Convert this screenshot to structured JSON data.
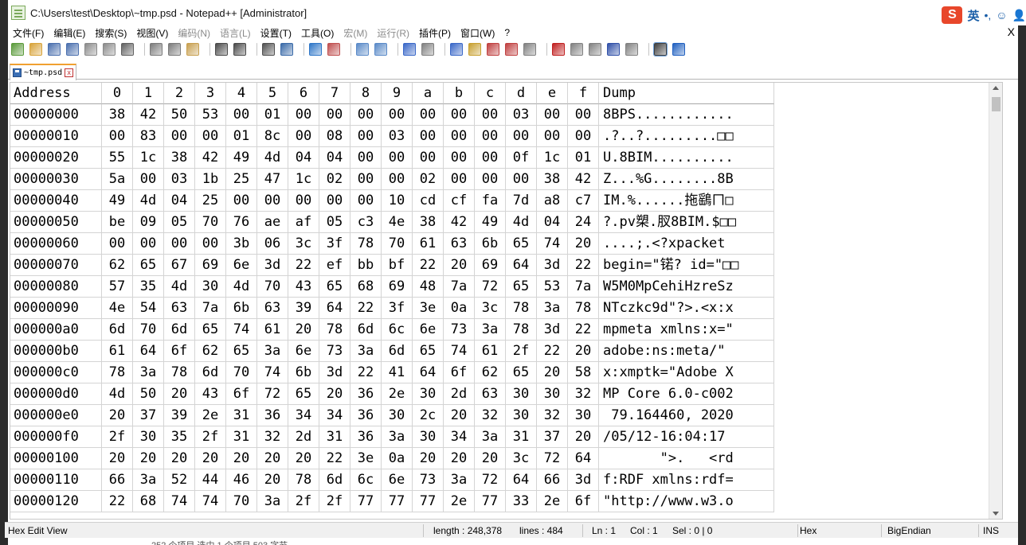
{
  "window": {
    "title": "C:\\Users\\test\\Desktop\\~tmp.psd - Notepad++ [Administrator]"
  },
  "ime": {
    "logo": "S",
    "lang": "英",
    "punct": "•,",
    "emoji": "☺",
    "user": "👤"
  },
  "close_symbol": "X",
  "menu": [
    {
      "label": "文件(F)",
      "disabled": false
    },
    {
      "label": "编辑(E)",
      "disabled": false
    },
    {
      "label": "搜索(S)",
      "disabled": false
    },
    {
      "label": "视图(V)",
      "disabled": false
    },
    {
      "label": "编码(N)",
      "disabled": true
    },
    {
      "label": "语言(L)",
      "disabled": true
    },
    {
      "label": "设置(T)",
      "disabled": false
    },
    {
      "label": "工具(O)",
      "disabled": false
    },
    {
      "label": "宏(M)",
      "disabled": true
    },
    {
      "label": "运行(R)",
      "disabled": true
    },
    {
      "label": "插件(P)",
      "disabled": false
    },
    {
      "label": "窗口(W)",
      "disabled": false
    },
    {
      "label": "?",
      "disabled": false
    }
  ],
  "toolbar_icons": [
    "new-file-icon",
    "open-file-icon",
    "save-icon",
    "save-all-icon",
    "close-icon",
    "close-all-icon",
    "print-icon",
    "sep",
    "cut-icon",
    "copy-icon",
    "paste-icon",
    "sep",
    "undo-icon",
    "redo-icon",
    "sep",
    "find-icon",
    "replace-icon",
    "sep",
    "zoom-in-icon",
    "zoom-out-icon",
    "sep",
    "sync-v-icon",
    "sync-h-icon",
    "sep",
    "word-wrap-icon",
    "all-chars-icon",
    "sep",
    "indent-guide-icon",
    "doc-map-icon",
    "function-list-icon",
    "folder-workspace-icon",
    "monitoring-icon",
    "sep",
    "record-macro-icon",
    "stop-record-icon",
    "play-macro-icon",
    "run-macro-multiple-icon",
    "save-macro-icon",
    "sep",
    "hex-editor-icon",
    "compare-icon"
  ],
  "tab": {
    "label": "~tmp.psd",
    "close": "x"
  },
  "hex": {
    "header": [
      "Address",
      "0",
      "1",
      "2",
      "3",
      "4",
      "5",
      "6",
      "7",
      "8",
      "9",
      "a",
      "b",
      "c",
      "d",
      "e",
      "f",
      "Dump"
    ],
    "rows": [
      {
        "addr": "00000000",
        "bytes": [
          "38",
          "42",
          "50",
          "53",
          "00",
          "01",
          "00",
          "00",
          "00",
          "00",
          "00",
          "00",
          "00",
          "03",
          "00",
          "00"
        ],
        "dump": "8BPS............"
      },
      {
        "addr": "00000010",
        "bytes": [
          "00",
          "83",
          "00",
          "00",
          "01",
          "8c",
          "00",
          "08",
          "00",
          "03",
          "00",
          "00",
          "00",
          "00",
          "00",
          "00"
        ],
        "dump": ".?..?.........□□"
      },
      {
        "addr": "00000020",
        "bytes": [
          "55",
          "1c",
          "38",
          "42",
          "49",
          "4d",
          "04",
          "04",
          "00",
          "00",
          "00",
          "00",
          "00",
          "0f",
          "1c",
          "01"
        ],
        "dump": "U.8BIM.........."
      },
      {
        "addr": "00000030",
        "bytes": [
          "5a",
          "00",
          "03",
          "1b",
          "25",
          "47",
          "1c",
          "02",
          "00",
          "00",
          "02",
          "00",
          "00",
          "00",
          "38",
          "42"
        ],
        "dump": "Z...%G........8B"
      },
      {
        "addr": "00000040",
        "bytes": [
          "49",
          "4d",
          "04",
          "25",
          "00",
          "00",
          "00",
          "00",
          "00",
          "10",
          "cd",
          "cf",
          "fa",
          "7d",
          "a8",
          "c7"
        ],
        "dump": "IM.%......拖鷂ㄇ□"
      },
      {
        "addr": "00000050",
        "bytes": [
          "be",
          "09",
          "05",
          "70",
          "76",
          "ae",
          "af",
          "05",
          "c3",
          "4e",
          "38",
          "42",
          "49",
          "4d",
          "04",
          "24"
        ],
        "dump": "?.pv槊.肞8BIM.$□□"
      },
      {
        "addr": "00000060",
        "bytes": [
          "00",
          "00",
          "00",
          "00",
          "3b",
          "06",
          "3c",
          "3f",
          "78",
          "70",
          "61",
          "63",
          "6b",
          "65",
          "74",
          "20"
        ],
        "dump": "....;.<?xpacket "
      },
      {
        "addr": "00000070",
        "bytes": [
          "62",
          "65",
          "67",
          "69",
          "6e",
          "3d",
          "22",
          "ef",
          "bb",
          "bf",
          "22",
          "20",
          "69",
          "64",
          "3d",
          "22"
        ],
        "dump": "begin=\"锘? id=\"□□"
      },
      {
        "addr": "00000080",
        "bytes": [
          "57",
          "35",
          "4d",
          "30",
          "4d",
          "70",
          "43",
          "65",
          "68",
          "69",
          "48",
          "7a",
          "72",
          "65",
          "53",
          "7a"
        ],
        "dump": "W5M0MpCehiHzreSz"
      },
      {
        "addr": "00000090",
        "bytes": [
          "4e",
          "54",
          "63",
          "7a",
          "6b",
          "63",
          "39",
          "64",
          "22",
          "3f",
          "3e",
          "0a",
          "3c",
          "78",
          "3a",
          "78"
        ],
        "dump": "NTczkc9d\"?>.<x:x"
      },
      {
        "addr": "000000a0",
        "bytes": [
          "6d",
          "70",
          "6d",
          "65",
          "74",
          "61",
          "20",
          "78",
          "6d",
          "6c",
          "6e",
          "73",
          "3a",
          "78",
          "3d",
          "22"
        ],
        "dump": "mpmeta xmlns:x=\""
      },
      {
        "addr": "000000b0",
        "bytes": [
          "61",
          "64",
          "6f",
          "62",
          "65",
          "3a",
          "6e",
          "73",
          "3a",
          "6d",
          "65",
          "74",
          "61",
          "2f",
          "22",
          "20"
        ],
        "dump": "adobe:ns:meta/\" "
      },
      {
        "addr": "000000c0",
        "bytes": [
          "78",
          "3a",
          "78",
          "6d",
          "70",
          "74",
          "6b",
          "3d",
          "22",
          "41",
          "64",
          "6f",
          "62",
          "65",
          "20",
          "58"
        ],
        "dump": "x:xmptk=\"Adobe X"
      },
      {
        "addr": "000000d0",
        "bytes": [
          "4d",
          "50",
          "20",
          "43",
          "6f",
          "72",
          "65",
          "20",
          "36",
          "2e",
          "30",
          "2d",
          "63",
          "30",
          "30",
          "32"
        ],
        "dump": "MP Core 6.0-c002"
      },
      {
        "addr": "000000e0",
        "bytes": [
          "20",
          "37",
          "39",
          "2e",
          "31",
          "36",
          "34",
          "34",
          "36",
          "30",
          "2c",
          "20",
          "32",
          "30",
          "32",
          "30"
        ],
        "dump": " 79.164460, 2020"
      },
      {
        "addr": "000000f0",
        "bytes": [
          "2f",
          "30",
          "35",
          "2f",
          "31",
          "32",
          "2d",
          "31",
          "36",
          "3a",
          "30",
          "34",
          "3a",
          "31",
          "37",
          "20"
        ],
        "dump": "/05/12-16:04:17 "
      },
      {
        "addr": "00000100",
        "bytes": [
          "20",
          "20",
          "20",
          "20",
          "20",
          "20",
          "20",
          "22",
          "3e",
          "0a",
          "20",
          "20",
          "20",
          "3c",
          "72",
          "64"
        ],
        "dump": "       \">.   <rd"
      },
      {
        "addr": "00000110",
        "bytes": [
          "66",
          "3a",
          "52",
          "44",
          "46",
          "20",
          "78",
          "6d",
          "6c",
          "6e",
          "73",
          "3a",
          "72",
          "64",
          "66",
          "3d"
        ],
        "dump": "f:RDF xmlns:rdf="
      },
      {
        "addr": "00000120",
        "bytes": [
          "22",
          "68",
          "74",
          "74",
          "70",
          "3a",
          "2f",
          "2f",
          "77",
          "77",
          "77",
          "2e",
          "77",
          "33",
          "2e",
          "6f"
        ],
        "dump": "\"http://www.w3.o"
      }
    ]
  },
  "status": {
    "mode": "Hex Edit View",
    "length": "length : 248,378",
    "lines": "lines : 484",
    "ln": "Ln : 1",
    "col": "Col : 1",
    "sel": "Sel : 0 | 0",
    "format": "Hex",
    "endian": "BigEndian",
    "ins": "INS"
  },
  "behind_text": "252 个项目    选中 1 个项目  503 字节",
  "colors": {
    "tab_accent": "#f0a030",
    "ime_logo": "#e8472b",
    "ime_text": "#1a5ea8"
  }
}
